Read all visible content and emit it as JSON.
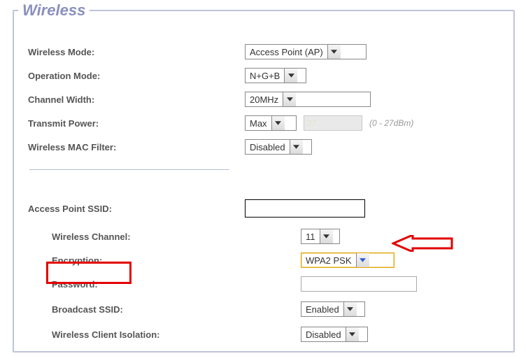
{
  "legend": "Wireless",
  "rows": {
    "wireless_mode": {
      "label": "Wireless Mode:",
      "value": "Access Point (AP)"
    },
    "operation_mode": {
      "label": "Operation Mode:",
      "value": "N+G+B"
    },
    "channel_width": {
      "label": "Channel Width:",
      "value": "20MHz"
    },
    "transmit_power": {
      "label": "Transmit Power:",
      "value": "Max",
      "dbm_value": "27",
      "dbm_hint": "(0 - 27dBm)"
    },
    "mac_filter": {
      "label": "Wireless MAC Filter:",
      "value": "Disabled"
    },
    "ap_ssid": {
      "label": "Access Point SSID:",
      "value": ""
    },
    "channel": {
      "label": "Wireless Channel:",
      "value": "11"
    },
    "encryption": {
      "label": "Encryption:",
      "value": "WPA2 PSK"
    },
    "password": {
      "label": "Password:",
      "value": ""
    },
    "broadcast": {
      "label": "Broadcast SSID:",
      "value": "Enabled"
    },
    "isolation": {
      "label": "Wireless Client Isolation:",
      "value": "Disabled"
    }
  }
}
